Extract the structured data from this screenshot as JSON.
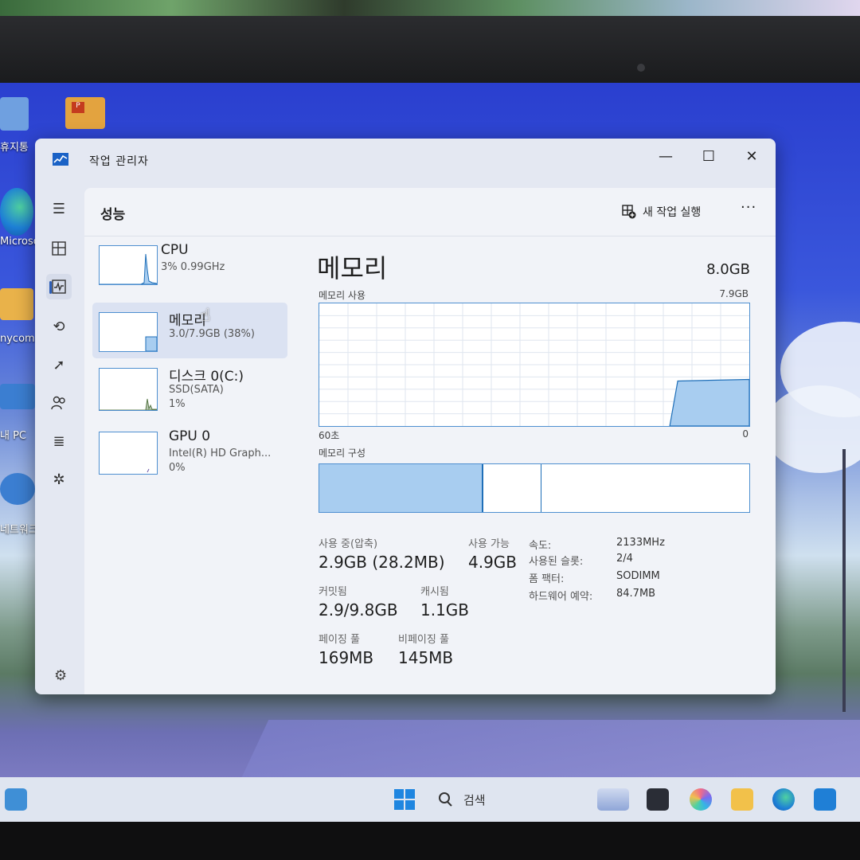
{
  "desktop": {
    "icons": [
      {
        "label": "휴지통",
        "color": "#3d7fd6"
      },
      {
        "label": "",
        "color": "#e0a340"
      },
      {
        "label": "Microsoft Edge",
        "color": "#1d8fd6"
      },
      {
        "label": "nycom",
        "color": "#e9b24a"
      },
      {
        "label": "내 PC",
        "color": "#3b7ed1"
      },
      {
        "label": "네트워크",
        "color": "#3b7ed1"
      }
    ]
  },
  "window": {
    "title": "작업 관리자",
    "controls": {
      "minimize": "—",
      "maximize": "☐",
      "close": "✕"
    }
  },
  "nav": {
    "items": [
      "menu-icon",
      "processes-icon",
      "performance-icon",
      "app-history-icon",
      "startup-icon",
      "users-icon",
      "details-icon",
      "services-icon",
      "settings-icon"
    ]
  },
  "header": {
    "title": "성능",
    "run_task": "새 작업 실행",
    "more": "···"
  },
  "perf_list": [
    {
      "name": "CPU",
      "sub": "3% 0.99GHz",
      "sub2": ""
    },
    {
      "name": "메모리",
      "sub": "3.0/7.9GB (38%)",
      "sub2": ""
    },
    {
      "name": "디스크 0(C:)",
      "sub": "SSD(SATA)",
      "sub2": "1%"
    },
    {
      "name": "GPU 0",
      "sub": "Intel(R) HD Graph...",
      "sub2": "0%"
    }
  ],
  "memory": {
    "title": "메모리",
    "total": "8.0GB",
    "usage_label": "메모리 사용",
    "usage_max": "7.9GB",
    "time_left": "60초",
    "time_right": "0",
    "composition_label": "메모리 구성",
    "usage_fraction": 0.38,
    "stats": {
      "in_use_label": "사용 중(압축)",
      "in_use_value": "2.9GB (28.2MB)",
      "available_label": "사용 가능",
      "available_value": "4.9GB",
      "committed_label": "커밋됨",
      "committed_value": "2.9/9.8GB",
      "cached_label": "캐시됨",
      "cached_value": "1.1GB",
      "paged_label": "페이징 풀",
      "paged_value": "169MB",
      "nonpaged_label": "비페이징 풀",
      "nonpaged_value": "145MB"
    },
    "props": [
      {
        "key": "속도:",
        "value": "2133MHz"
      },
      {
        "key": "사용된 슬롯:",
        "value": "2/4"
      },
      {
        "key": "폼 팩터:",
        "value": "SODIMM"
      },
      {
        "key": "하드웨어 예약:",
        "value": "84.7MB"
      }
    ]
  },
  "taskbar": {
    "search": "검색"
  }
}
